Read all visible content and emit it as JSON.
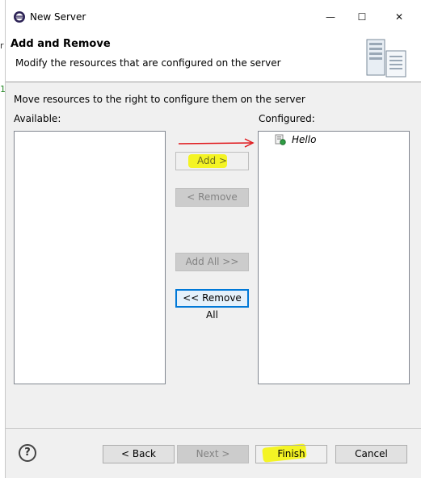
{
  "window": {
    "title": "New Server",
    "controls": {
      "minimize": "—",
      "maximize": "☐",
      "close": "✕"
    }
  },
  "background_bleed": {
    "left_char": "r",
    "left_digit": "1"
  },
  "header": {
    "title": "Add and Remove",
    "description": "Modify the resources that are configured on the server"
  },
  "instruction": "Move resources to the right to configure them on the server",
  "available": {
    "label": "Available:",
    "items": []
  },
  "configured": {
    "label": "Configured:",
    "items": [
      {
        "label": "Hello",
        "icon": "web-module-icon"
      }
    ]
  },
  "buttons": {
    "add": "Add >",
    "remove": "< Remove",
    "add_all": "Add All >>",
    "remove_all": "<< Remove All"
  },
  "footer": {
    "help": "?",
    "back": "< Back",
    "next": "Next >",
    "finish": "Finish",
    "cancel": "Cancel"
  },
  "colors": {
    "highlight": "#f4f400",
    "annotation_arrow": "#e0191d",
    "focus": "#0078d7"
  }
}
